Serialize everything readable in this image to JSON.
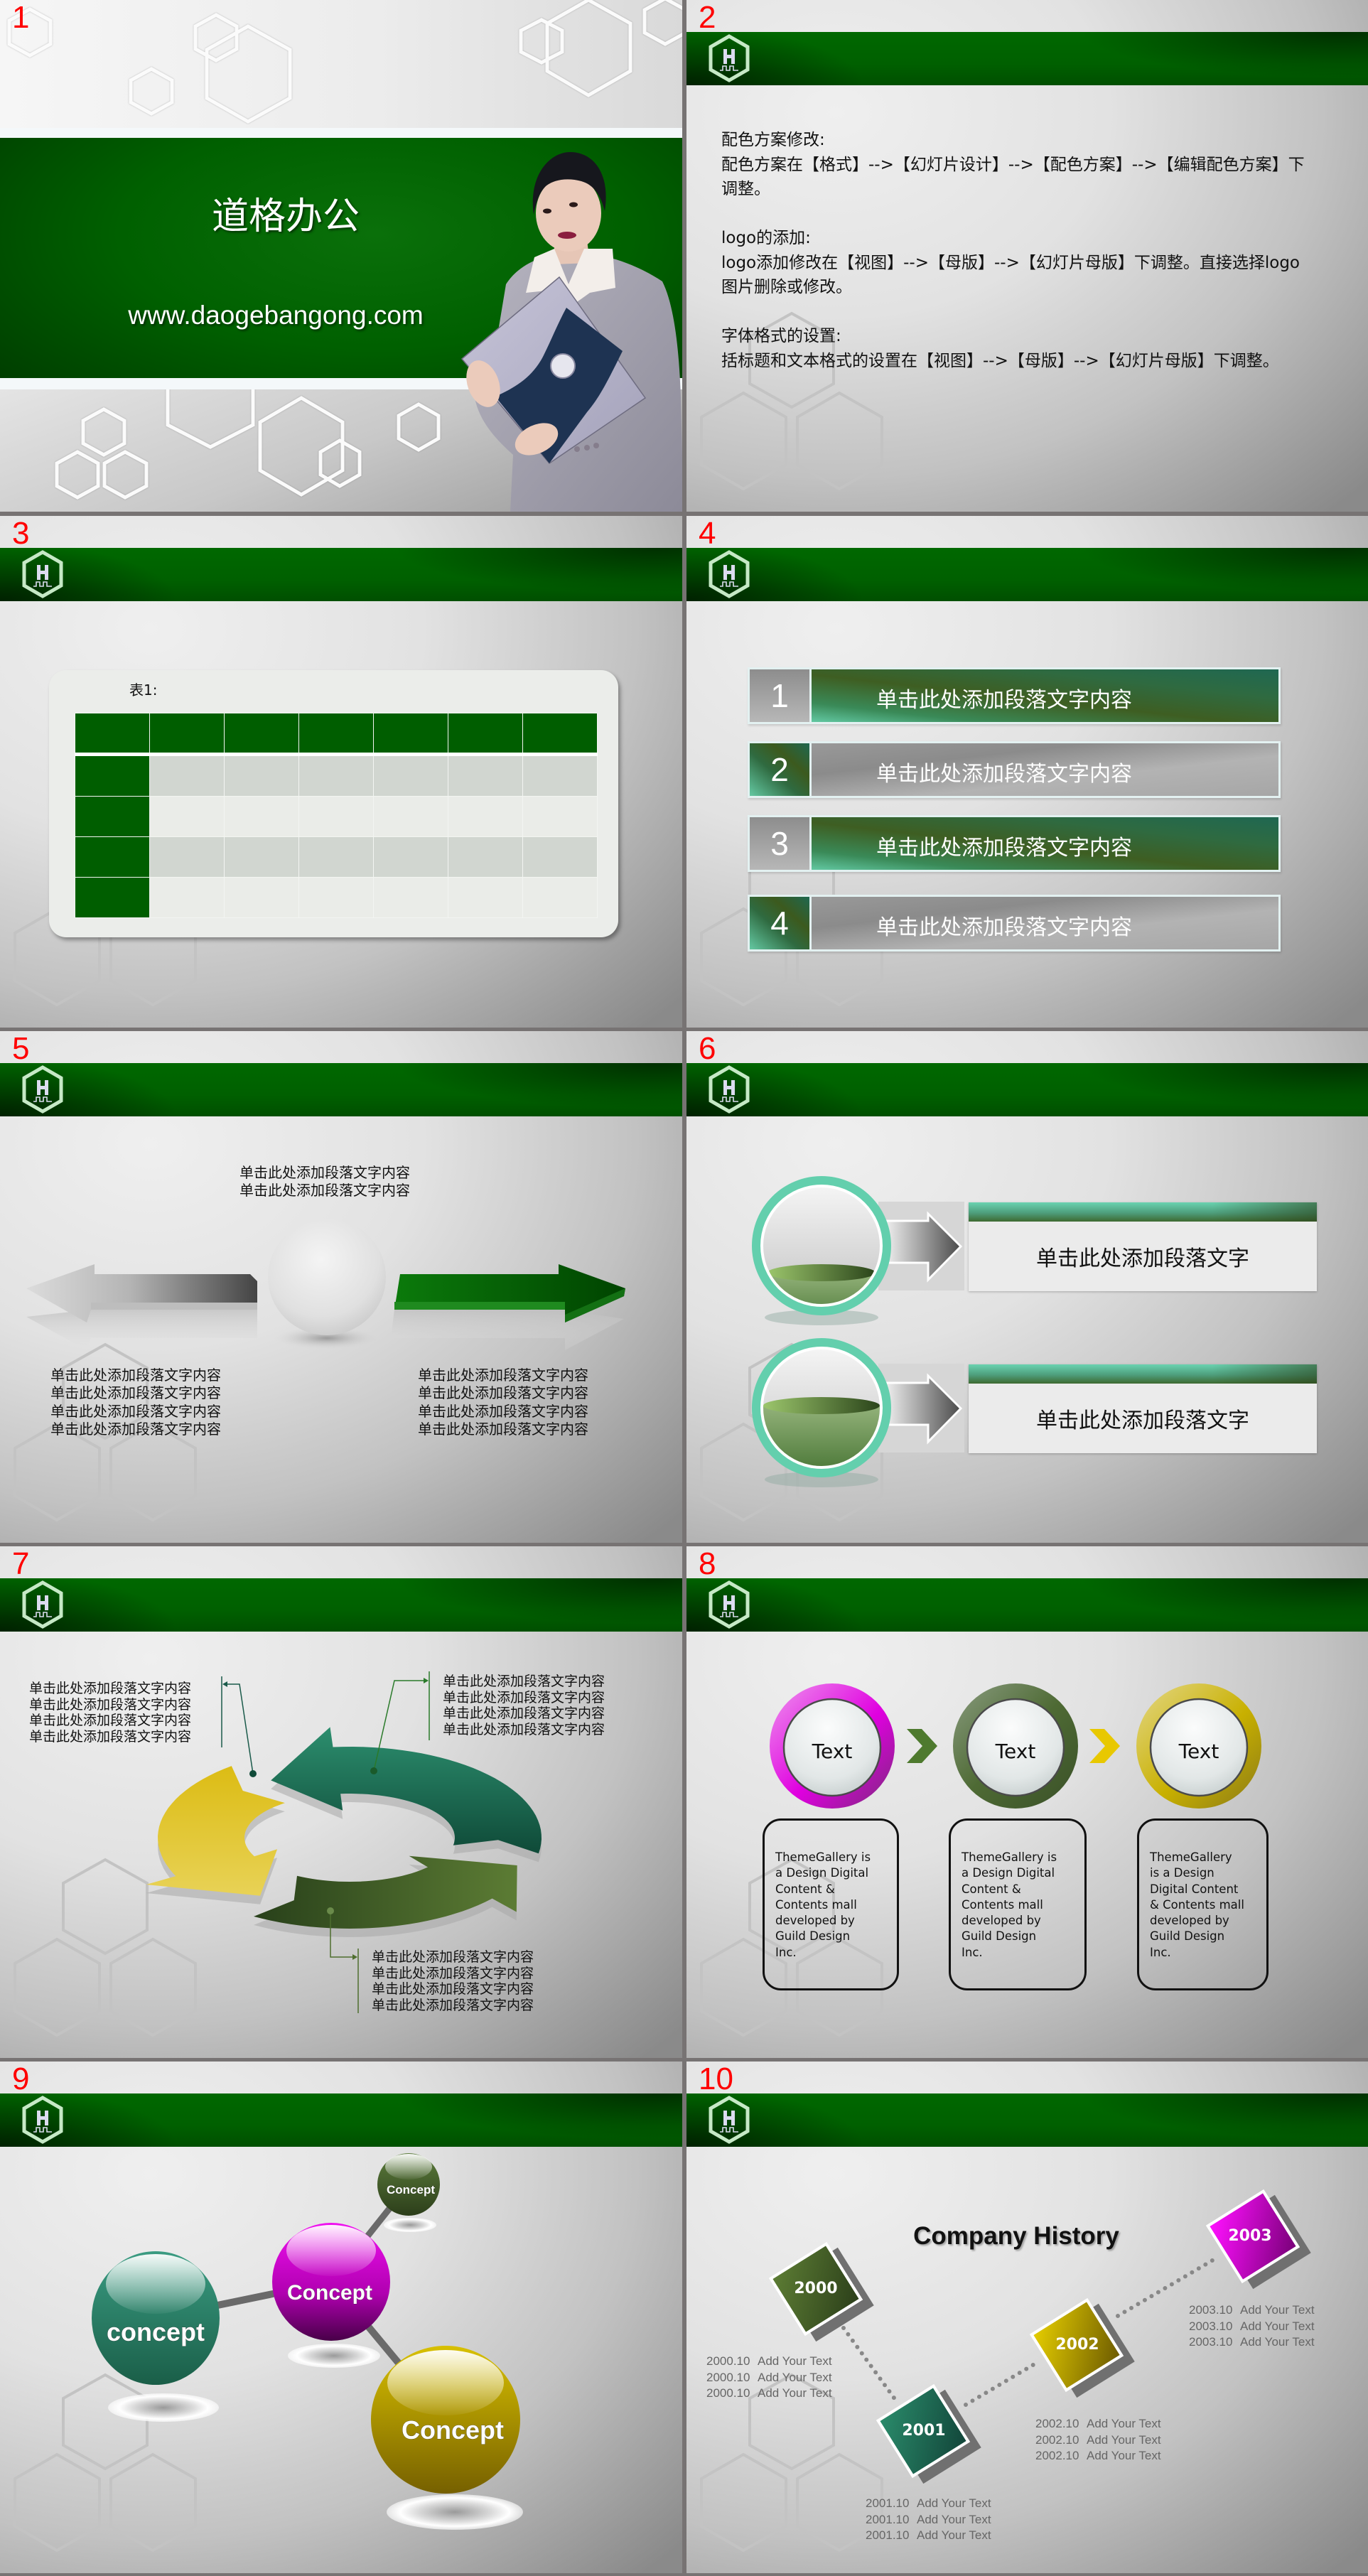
{
  "colors": {
    "brand_green": "#006000",
    "slide_number": "#ff0000",
    "teal": "#1e7a60",
    "mint": "#63cfad",
    "yellow": "#e0c22a",
    "olive": "#4e6e2e",
    "magenta": "#e000e0",
    "divider": "#777373"
  },
  "slides": [
    {
      "number": "1",
      "title": "道格办公",
      "url": "www.daogebangong.com"
    },
    {
      "number": "2",
      "sections": [
        {
          "heading": "配色方案修改:",
          "lines": [
            "配色方案在【格式】-->【幻灯片设计】-->【配色方案】-->【编辑配色方案】下",
            "调整。"
          ]
        },
        {
          "heading": "logo的添加:",
          "lines": [
            "logo添加修改在【视图】-->【母版】-->【幻灯片母版】下调整。直接选择logo",
            "图片删除或修改。"
          ]
        },
        {
          "heading": "字体格式的设置:",
          "lines": [
            "括标题和文本格式的设置在【视图】-->【母版】-->【幻灯片母版】下调整。"
          ]
        }
      ]
    },
    {
      "number": "3",
      "caption": "表1:",
      "table": {
        "header": [
          "",
          "",
          "",
          "",
          "",
          "",
          ""
        ],
        "rows": [
          [
            "",
            "",
            "",
            "",
            "",
            "",
            ""
          ],
          [
            "",
            "",
            "",
            "",
            "",
            "",
            ""
          ],
          [
            "",
            "",
            "",
            "",
            "",
            "",
            ""
          ],
          [
            "",
            "",
            "",
            "",
            "",
            "",
            ""
          ]
        ]
      }
    },
    {
      "number": "4",
      "items": [
        {
          "index": "1",
          "text": "单击此处添加段落文字内容"
        },
        {
          "index": "2",
          "text": "单击此处添加段落文字内容"
        },
        {
          "index": "3",
          "text": "单击此处添加段落文字内容"
        },
        {
          "index": "4",
          "text": "单击此处添加段落文字内容"
        }
      ]
    },
    {
      "number": "5",
      "top_text": [
        "单击此处添加段落文字内容",
        "单击此处添加段落文字内容"
      ],
      "left_text": [
        "单击此处添加段落文字内容",
        "单击此处添加段落文字内容",
        "单击此处添加段落文字内容",
        "单击此处添加段落文字内容"
      ],
      "right_text": [
        "单击此处添加段落文字内容",
        "单击此处添加段落文字内容",
        "单击此处添加段落文字内容",
        "单击此处添加段落文字内容"
      ]
    },
    {
      "number": "6",
      "items": [
        {
          "text": "单击此处添加段落文字"
        },
        {
          "text": "单击此处添加段落文字"
        }
      ]
    },
    {
      "number": "7",
      "callouts": [
        {
          "lines": [
            "单击此处添加段落文字内容",
            "单击此处添加段落文字内容",
            "单击此处添加段落文字内容",
            "单击此处添加段落文字内容"
          ]
        },
        {
          "lines": [
            "单击此处添加段落文字内容",
            "单击此处添加段落文字内容",
            "单击此处添加段落文字内容",
            "单击此处添加段落文字内容"
          ]
        },
        {
          "lines": [
            "单击此处添加段落文字内容",
            "单击此处添加段落文字内容",
            "单击此处添加段落文字内容",
            "单击此处添加段落文字内容"
          ]
        }
      ]
    },
    {
      "number": "8",
      "steps": [
        {
          "label": "Text",
          "desc": [
            "ThemeGallery is",
            "a Design Digital",
            "Content &",
            "Contents mall",
            "developed by",
            "Guild Design",
            "Inc."
          ]
        },
        {
          "label": "Text",
          "desc": [
            "ThemeGallery is",
            "a Design Digital",
            "Content &",
            "Contents mall",
            "developed by",
            "Guild Design",
            "Inc."
          ]
        },
        {
          "label": "Text",
          "desc": [
            "ThemeGallery",
            "is a Design",
            "Digital Content",
            "& Contents mall",
            "developed by",
            "Guild Design",
            "Inc."
          ]
        }
      ]
    },
    {
      "number": "9",
      "nodes": [
        {
          "label": "concept"
        },
        {
          "label": "Concept"
        },
        {
          "label": "Concept"
        },
        {
          "label": "Concept"
        }
      ]
    },
    {
      "number": "10",
      "title": "Company History",
      "milestones": [
        {
          "year": "2000",
          "notes": [
            {
              "date": "2000.10",
              "text": "Add Your Text"
            },
            {
              "date": "2000.10",
              "text": "Add Your Text"
            },
            {
              "date": "2000.10",
              "text": "Add Your Text"
            }
          ]
        },
        {
          "year": "2001",
          "notes": [
            {
              "date": "2001.10",
              "text": "Add Your Text"
            },
            {
              "date": "2001.10",
              "text": "Add Your Text"
            },
            {
              "date": "2001.10",
              "text": "Add Your Text"
            }
          ]
        },
        {
          "year": "2002",
          "notes": [
            {
              "date": "2002.10",
              "text": "Add Your Text"
            },
            {
              "date": "2002.10",
              "text": "Add Your Text"
            },
            {
              "date": "2002.10",
              "text": "Add Your Text"
            }
          ]
        },
        {
          "year": "2003",
          "notes": [
            {
              "date": "2003.10",
              "text": "Add Your Text"
            },
            {
              "date": "2003.10",
              "text": "Add Your Text"
            },
            {
              "date": "2003.10",
              "text": "Add Your Text"
            }
          ]
        }
      ]
    }
  ]
}
